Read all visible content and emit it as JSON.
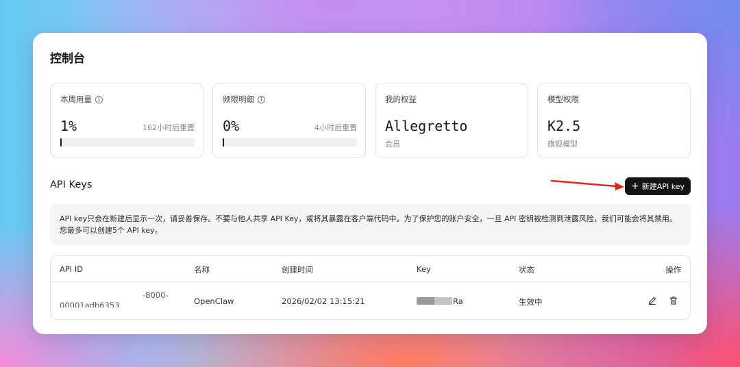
{
  "page_title": "控制台",
  "stats": [
    {
      "label": "本周用量",
      "value": "1%",
      "note": "162小时后重置",
      "progress": 0.01
    },
    {
      "label": "频限明细",
      "value": "0%",
      "note": "4小时后重置",
      "progress": 0.0
    },
    {
      "label": "我的权益",
      "value": "Allegretto",
      "sub": "会员"
    },
    {
      "label": "模型权限",
      "value": "K2.5",
      "sub": "旗舰模型"
    }
  ],
  "api_keys": {
    "title": "API Keys",
    "new_button_label": "新建API key",
    "notice": "API key只会在新建后显示一次，请妥善保存。不要与他人共享 API Key，或将其暴露在客户端代码中。为了保护您的账户安全，一旦 API 密钥被检测到泄露风险，我们可能会将其禁用。您最多可以创建5个 API key。",
    "columns": [
      "API ID",
      "名称",
      "创建时间",
      "Key",
      "状态",
      "操作"
    ],
    "rows": [
      {
        "api_id_line1": "-8000-",
        "api_id_line2": "00001adb6353",
        "name": "OpenClaw",
        "created": "2026/02/02 13:15:21",
        "key_suffix": "Ra",
        "status": "生效中"
      }
    ]
  },
  "colors": {
    "accent": "#141414",
    "arrow": "#e0261c"
  },
  "icons": [
    "info-icon",
    "plus-icon",
    "edit-icon",
    "trash-icon"
  ]
}
